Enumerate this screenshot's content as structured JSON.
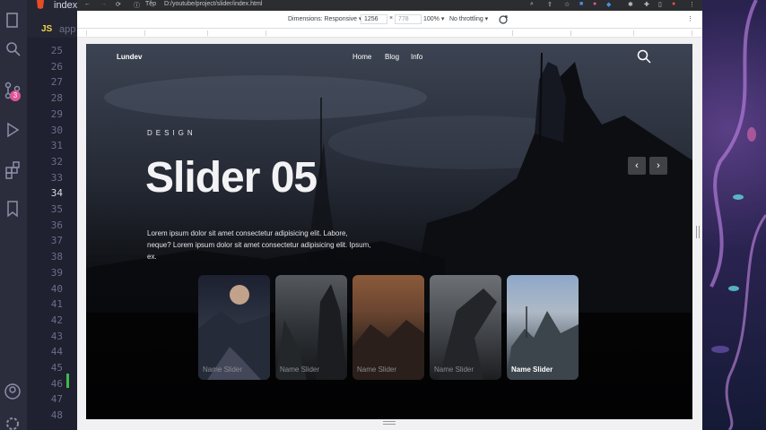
{
  "editor": {
    "tab_html": "index",
    "tab_js_icon": "JS",
    "tab_js": "app",
    "line_numbers": [
      "25",
      "26",
      "27",
      "28",
      "29",
      "30",
      "31",
      "32",
      "33",
      "34",
      "35",
      "36",
      "37",
      "38",
      "39",
      "40",
      "41",
      "42",
      "43",
      "44",
      "45",
      "46",
      "47",
      "48"
    ],
    "current_line": "34",
    "scm_badge": "3"
  },
  "browser": {
    "url_prefix": "Tệp",
    "url": "D:/youtube/project/slider/index.html",
    "dimensions_label": "Dimensions: Responsive ▾",
    "width": "1256",
    "times": "×",
    "height": "778",
    "zoom": "100% ▾",
    "throttling": "No throttling ▾"
  },
  "page": {
    "logo": "Lundev",
    "nav": [
      "Home",
      "Blog",
      "Info"
    ],
    "kicker": "DESIGN",
    "title": "Slider 05",
    "description": "Lorem ipsum dolor sit amet consectetur adipisicing elit. Labore, neque? Lorem ipsum dolor sit amet consectetur adipisicing elit. Ipsum, ex.",
    "prev_arrow": "‹",
    "next_arrow": "›",
    "thumbnails": [
      {
        "caption": "Name Slider",
        "active": false
      },
      {
        "caption": "Name Slider",
        "active": false
      },
      {
        "caption": "Name Slider",
        "active": false
      },
      {
        "caption": "Name Slider",
        "active": false
      },
      {
        "caption": "Name Slider",
        "active": true
      }
    ]
  }
}
